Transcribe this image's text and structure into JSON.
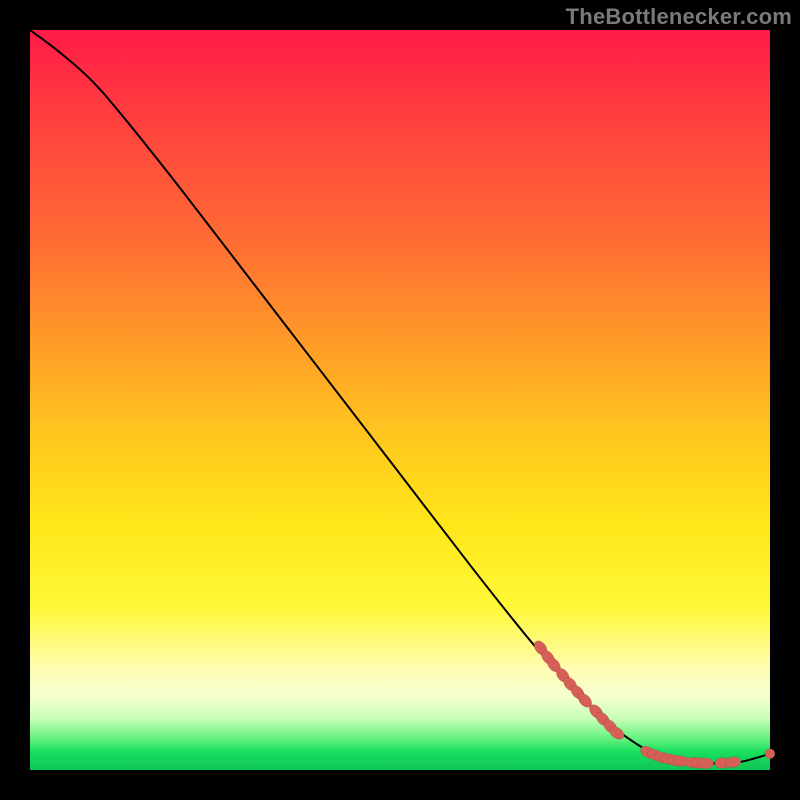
{
  "watermark": "TheBottlenecker.com",
  "chart_data": {
    "type": "line",
    "title": "",
    "xlabel": "",
    "ylabel": "",
    "xlim": [
      0,
      100
    ],
    "ylim": [
      0,
      100
    ],
    "grid": false,
    "legend": false,
    "series": [
      {
        "name": "curve",
        "points": [
          [
            0,
            100
          ],
          [
            4,
            97
          ],
          [
            8,
            93.5
          ],
          [
            12,
            89
          ],
          [
            20,
            79
          ],
          [
            30,
            66
          ],
          [
            40,
            53
          ],
          [
            50,
            40
          ],
          [
            60,
            27
          ],
          [
            68,
            17
          ],
          [
            73,
            11.5
          ],
          [
            78,
            6.5
          ],
          [
            82,
            3.5
          ],
          [
            85,
            2
          ],
          [
            88,
            1.2
          ],
          [
            92,
            0.9
          ],
          [
            96,
            1.1
          ],
          [
            100,
            2.2
          ]
        ]
      }
    ],
    "markers": [
      {
        "x": 69.0,
        "y": 16.5
      },
      {
        "x": 70.0,
        "y": 15.2
      },
      {
        "x": 70.8,
        "y": 14.2
      },
      {
        "x": 72.0,
        "y": 12.8
      },
      {
        "x": 73.0,
        "y": 11.6
      },
      {
        "x": 74.0,
        "y": 10.5
      },
      {
        "x": 75.0,
        "y": 9.4
      },
      {
        "x": 76.5,
        "y": 7.9
      },
      {
        "x": 77.4,
        "y": 6.9
      },
      {
        "x": 78.4,
        "y": 5.9
      },
      {
        "x": 79.3,
        "y": 5.0
      },
      {
        "x": 83.5,
        "y": 2.4
      },
      {
        "x": 84.5,
        "y": 2.0
      },
      {
        "x": 85.4,
        "y": 1.7
      },
      {
        "x": 86.3,
        "y": 1.5
      },
      {
        "x": 87.2,
        "y": 1.3
      },
      {
        "x": 88.0,
        "y": 1.2
      },
      {
        "x": 89.6,
        "y": 1.0
      },
      {
        "x": 90.5,
        "y": 0.95
      },
      {
        "x": 91.3,
        "y": 0.9
      },
      {
        "x": 93.6,
        "y": 0.95
      },
      {
        "x": 95.0,
        "y": 1.05
      },
      {
        "x": 100.0,
        "y": 2.2
      }
    ]
  }
}
